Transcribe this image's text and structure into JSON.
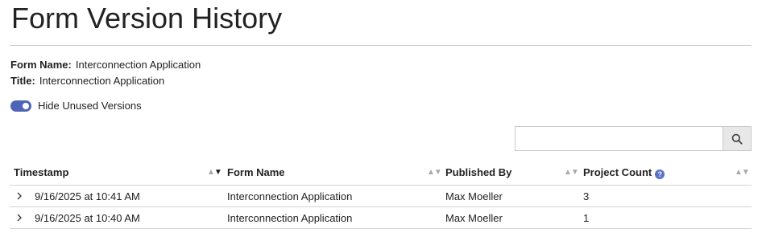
{
  "page": {
    "title": "Form Version History"
  },
  "meta": {
    "form_name_label": "Form Name:",
    "form_name_value": "Interconnection Application",
    "title_label": "Title:",
    "title_value": "Interconnection Application"
  },
  "toggle": {
    "label": "Hide Unused Versions",
    "checked": true,
    "color": "#4f64b8"
  },
  "search": {
    "value": "",
    "placeholder": "",
    "icon": "search-icon"
  },
  "table": {
    "columns": [
      {
        "label": "Timestamp",
        "sort": "descending"
      },
      {
        "label": "Form Name",
        "sort": "none"
      },
      {
        "label": "Published By",
        "sort": "none"
      },
      {
        "label": "Project Count",
        "sort": "none",
        "help_icon": "?"
      }
    ],
    "rows": [
      {
        "timestamp": "9/16/2025 at 10:41 AM",
        "form_name": "Interconnection Application",
        "published_by": "Max Moeller",
        "project_count": "3"
      },
      {
        "timestamp": "9/16/2025 at 10:40 AM",
        "form_name": "Interconnection Application",
        "published_by": "Max Moeller",
        "project_count": "1"
      }
    ]
  },
  "colors": {
    "accent": "#4f64b8",
    "divider": "#d4d4d4"
  }
}
